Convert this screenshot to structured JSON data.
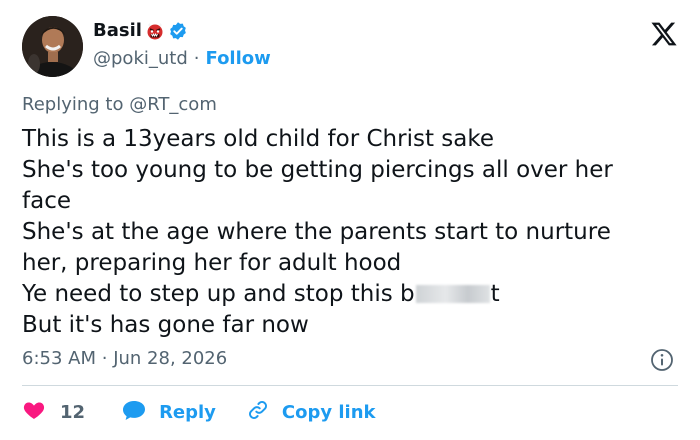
{
  "author": {
    "display_name": "Basil",
    "handle": "@poki_utd",
    "separator": "·",
    "follow_label": "Follow",
    "badge_icon": "red-ogre-emoji-icon",
    "verified_icon": "verified-badge-icon",
    "avatar_icon": "profile-avatar"
  },
  "platform_icon": "x-logo-icon",
  "reply_context": {
    "prefix": "Replying to",
    "mention": "@RT_com"
  },
  "body_lines": [
    "This is a 13years old child for Christ sake",
    "She's too young to be getting piercings all over her",
    "face",
    "She's at the age where the parents start to nurture",
    "her, preparing her for adult hood",
    "Ye need to step up and stop this b",
    "t",
    "But it's has gone far now"
  ],
  "timestamp": {
    "time": "6:53 AM",
    "separator": "·",
    "date": "Jun 28, 2026"
  },
  "actions": {
    "like_count": "12",
    "reply_label": "Reply",
    "copy_link_label": "Copy link"
  },
  "colors": {
    "accent": "#1d9bf0",
    "muted_text": "#536471",
    "heart": "#f91880",
    "text": "#0f1419",
    "divider": "#cfd9de"
  }
}
